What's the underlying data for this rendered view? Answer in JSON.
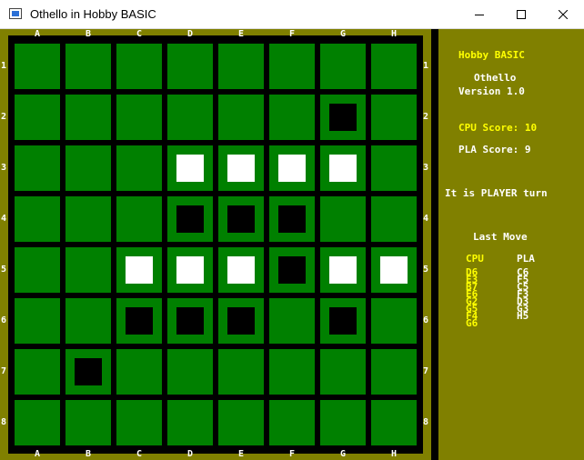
{
  "window": {
    "title": "Othello in Hobby BASIC"
  },
  "board": {
    "columns": [
      "A",
      "B",
      "C",
      "D",
      "E",
      "F",
      "G",
      "H"
    ],
    "rows": [
      "1",
      "2",
      "3",
      "4",
      "5",
      "6",
      "7",
      "8"
    ],
    "grid": [
      [
        "",
        "",
        "",
        "",
        "",
        "",
        "",
        ""
      ],
      [
        "",
        "",
        "",
        "",
        "",
        "",
        "B",
        ""
      ],
      [
        "",
        "",
        "",
        "W",
        "W",
        "W",
        "W",
        ""
      ],
      [
        "",
        "",
        "",
        "B",
        "B",
        "B",
        "",
        ""
      ],
      [
        "",
        "",
        "W",
        "W",
        "W",
        "B",
        "W",
        "W"
      ],
      [
        "",
        "",
        "B",
        "B",
        "B",
        "",
        "B",
        ""
      ],
      [
        "",
        "B",
        "",
        "",
        "",
        "",
        "",
        ""
      ],
      [
        "",
        "",
        "",
        "",
        "",
        "",
        "",
        ""
      ]
    ]
  },
  "panel": {
    "app_name": "Hobby BASIC",
    "game_name": "Othello",
    "version": "Version 1.0",
    "cpu_score": "CPU Score: 10",
    "pla_score": "PLA Score: 9",
    "turn": "It is PLAYER turn",
    "last_move_title": "Last Move",
    "cpu_header": "CPU",
    "pla_header": "PLA",
    "cpu_moves": [
      "D6",
      "E3",
      "B7",
      "E6",
      "G2",
      "G5",
      "F4",
      "G6"
    ],
    "pla_moves": [
      "C6",
      "F5",
      "C5",
      "F3",
      "D3",
      "G3",
      "H5"
    ]
  },
  "colors": {
    "board_green": "#008000",
    "frame_olive": "#808000",
    "accent_yellow": "#ffff00"
  }
}
